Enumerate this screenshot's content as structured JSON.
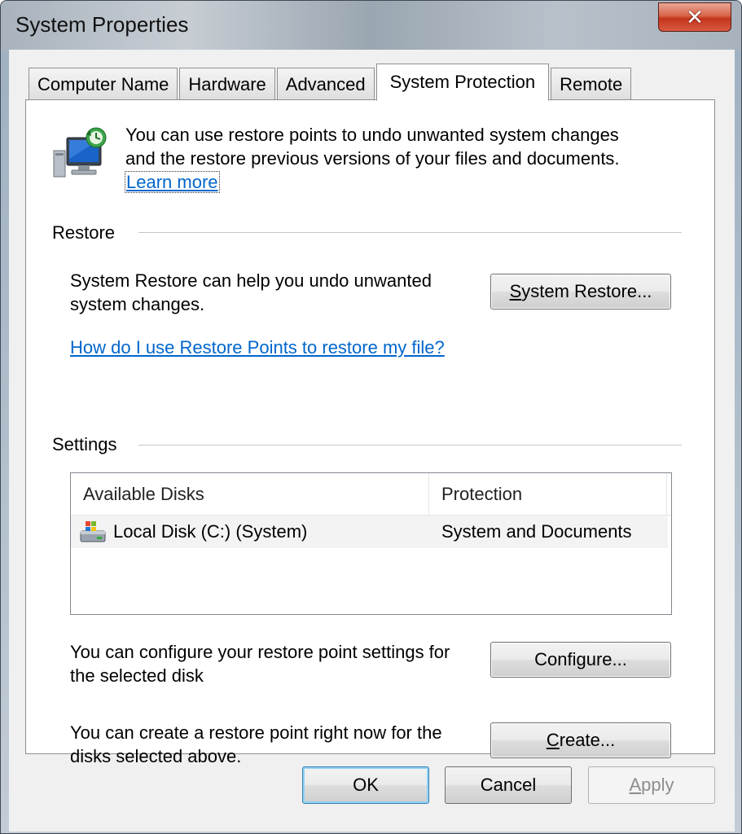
{
  "window": {
    "title": "System Properties",
    "close_label": "✕"
  },
  "tabs": [
    {
      "label": "Computer Name",
      "active": false
    },
    {
      "label": "Hardware",
      "active": false
    },
    {
      "label": "Advanced",
      "active": false
    },
    {
      "label": "System Protection",
      "active": true
    },
    {
      "label": "Remote",
      "active": false
    }
  ],
  "intro": {
    "icon": "system-restore-computer-icon",
    "line1": "You can use restore points to undo unwanted system changes",
    "line2": "and the restore previous versions of your files and documents.",
    "learn_more": "Learn more"
  },
  "restore": {
    "heading": "Restore",
    "desc_line1": "System Restore can help you undo unwanted",
    "desc_line2": "system changes.",
    "button_mnemonic": "S",
    "button_rest": "ystem Restore...",
    "help_link": "How do I use Restore Points to restore my file?"
  },
  "settings": {
    "heading": "Settings",
    "columns": [
      "Available Disks",
      "Protection"
    ],
    "rows": [
      {
        "icon": "local-disk-icon",
        "disk": "Local Disk (C:) (System)",
        "protection": "System and Documents"
      }
    ],
    "configure_desc_line1": "You can configure your restore point settings for",
    "configure_desc_line2": "the selected disk",
    "configure_pre": "Confi",
    "configure_mnemonic": "g",
    "configure_post": "ure...",
    "create_desc_line1": "You can create a restore point right now for the",
    "create_desc_line2": "disks selected above.",
    "create_mnemonic": "C",
    "create_post": "reate..."
  },
  "footer": {
    "ok": "OK",
    "cancel": "Cancel",
    "apply_mnemonic": "A",
    "apply_post": "pply"
  },
  "colors": {
    "link": "#0066cc",
    "close_button": "#c4361e",
    "default_button_border": "#3c7fb1"
  }
}
